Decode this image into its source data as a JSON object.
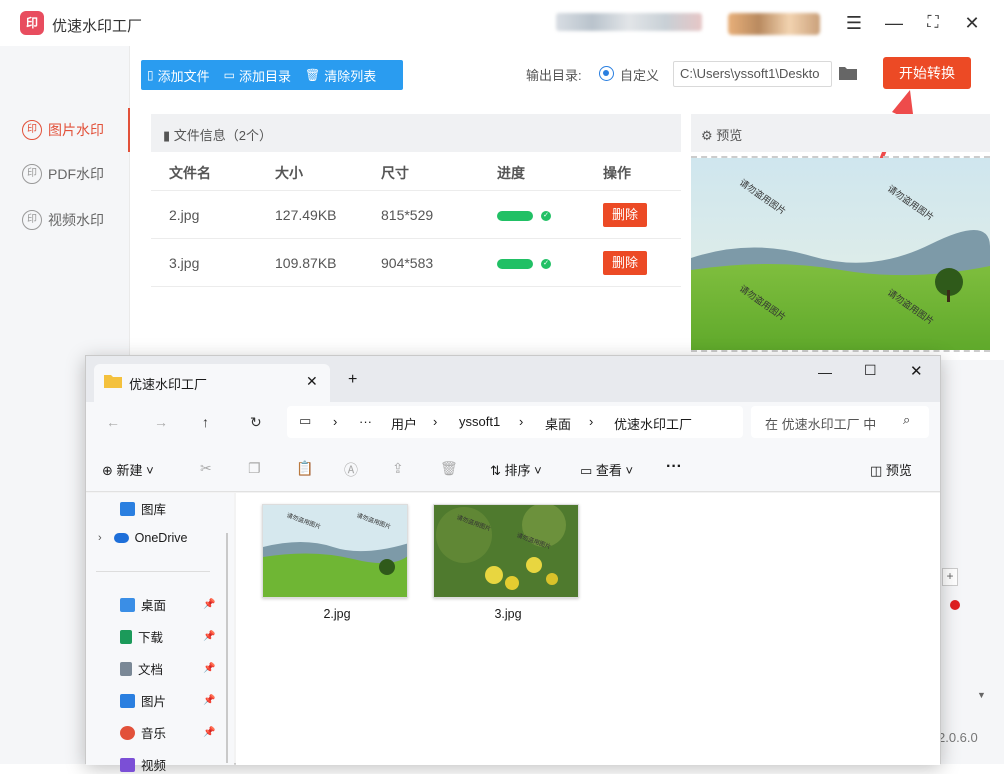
{
  "app": {
    "logo_text": "印",
    "title": "优速水印工厂",
    "minimize": "—",
    "maximize": "⛶",
    "close": "✕",
    "menu": "☰",
    "version": "2.0.6.0"
  },
  "sidebar": {
    "items": [
      {
        "label": "图片水印",
        "icon": "印"
      },
      {
        "label": "PDF水印",
        "icon": "印"
      },
      {
        "label": "视频水印",
        "icon": "印"
      }
    ]
  },
  "toolbar": {
    "add_file": "添加文件",
    "add_dir": "添加目录",
    "clear_list": "清除列表",
    "output_label": "输出目录:",
    "radio_label": "自定义",
    "path_value": "C:\\Users\\yssoft1\\Deskto",
    "start": "开始转换"
  },
  "file_list": {
    "header": "文件信息（2个）",
    "columns": [
      "文件名",
      "大小",
      "尺寸",
      "进度",
      "操作"
    ],
    "rows": [
      {
        "name": "2.jpg",
        "size": "127.49KB",
        "dim": "815*529",
        "progress": 1.0,
        "action": "删除"
      },
      {
        "name": "3.jpg",
        "size": "109.87KB",
        "dim": "904*583",
        "progress": 1.0,
        "action": "删除"
      }
    ]
  },
  "preview": {
    "header": "预览",
    "watermark": "请勿盗用图片"
  },
  "explorer": {
    "tab_title": "优速水印工厂",
    "new_tab": "+",
    "breadcrumb": [
      "用户",
      "yssoft1",
      "桌面",
      "优速水印工厂"
    ],
    "search_placeholder": "在 优速水印工厂 中",
    "cmd": {
      "new": "新建",
      "sort": "排序",
      "view": "查看",
      "more": "···",
      "preview": "预览"
    },
    "side": [
      {
        "label": "图库",
        "color": "#2a7fe0"
      },
      {
        "label": "OneDrive",
        "color": "#1e6fd9"
      },
      {
        "label": "桌面",
        "color": "#3a8ee6"
      },
      {
        "label": "下载",
        "color": "#1b9a5a"
      },
      {
        "label": "文档",
        "color": "#7a8896"
      },
      {
        "label": "图片",
        "color": "#2a7fe0"
      },
      {
        "label": "音乐",
        "color": "#e2513a"
      },
      {
        "label": "视频",
        "color": "#7b4fd6"
      }
    ],
    "files": [
      {
        "name": "2.jpg",
        "watermark": "请勿盗用图片"
      },
      {
        "name": "3.jpg",
        "watermark": "请勿盗用图片"
      }
    ]
  }
}
